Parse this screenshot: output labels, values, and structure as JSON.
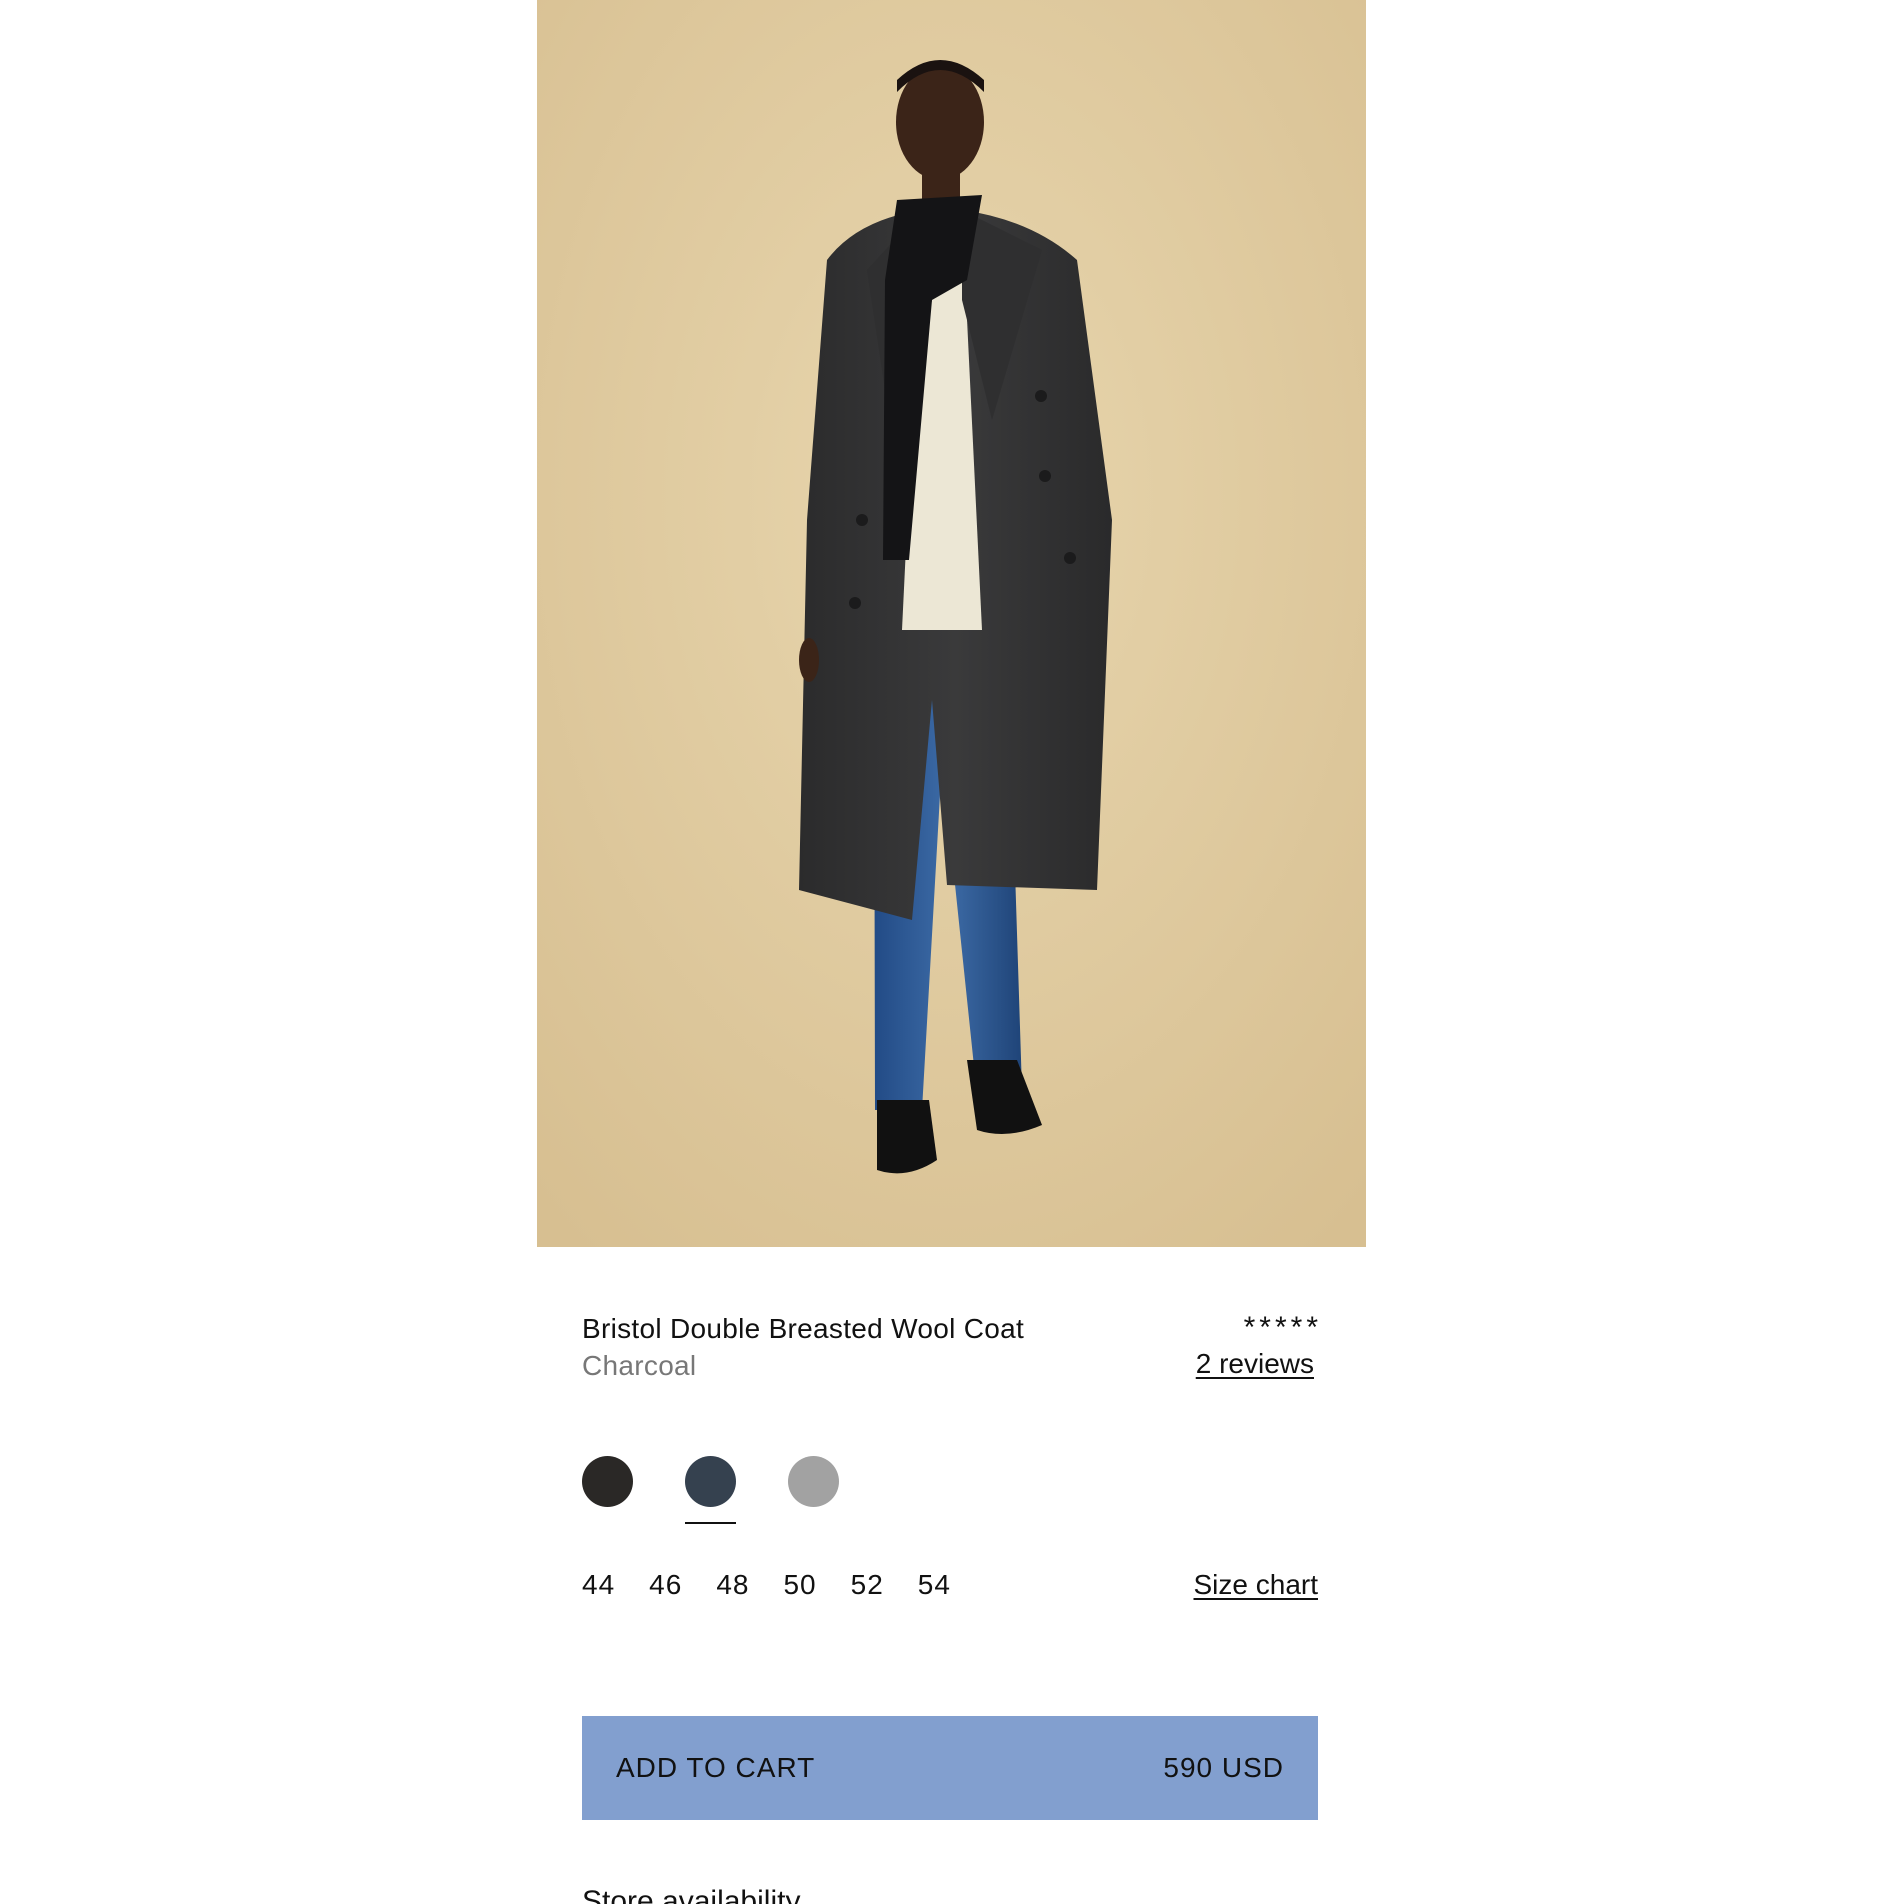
{
  "product": {
    "name": "Bristol Double Breasted Wool Coat",
    "color_name": "Charcoal",
    "rating_stars": "*****",
    "reviews_label": "2 reviews",
    "image_description_icon": "product-photo"
  },
  "swatches": [
    {
      "name": "black",
      "hex": "#2a2826",
      "selected": false
    },
    {
      "name": "navy",
      "hex": "#35414f",
      "selected": true
    },
    {
      "name": "grey",
      "hex": "#a2a2a2",
      "selected": false
    }
  ],
  "sizes": [
    "44",
    "46",
    "48",
    "50",
    "52",
    "54"
  ],
  "size_chart_label": "Size chart",
  "cart": {
    "label": "ADD TO CART",
    "price": "590 USD"
  },
  "store_availability_label": "Store availability",
  "colors": {
    "accent": "#829fcf",
    "background_photo": "#e3cfa3"
  }
}
